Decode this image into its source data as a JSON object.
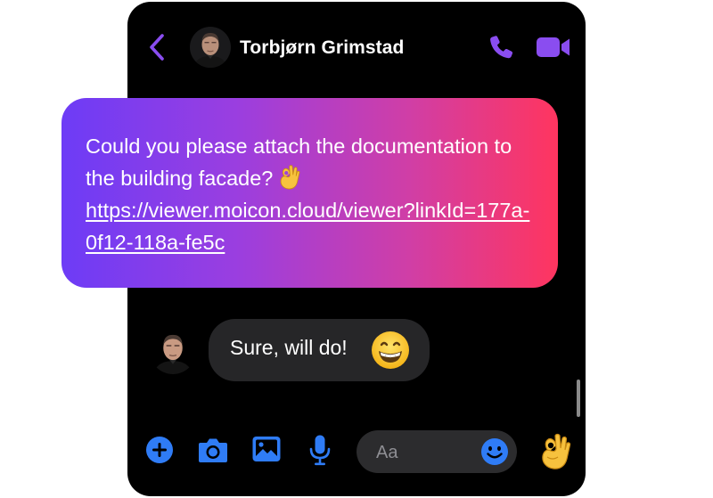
{
  "header": {
    "contact_name": "Torbjørn Grimstad"
  },
  "messages": {
    "outgoing": {
      "text": "Could you please attach the documentation to the building facade?",
      "link": "https://viewer.moicon.cloud/viewer?linkId=177a-0f12-118a-fe5c"
    },
    "incoming": {
      "text": "Sure, will do!"
    }
  },
  "composer": {
    "placeholder": "Aa"
  },
  "icons": {
    "back": "chevron-left-icon",
    "call": "phone-icon",
    "video": "video-camera-icon",
    "add": "plus-circle-icon",
    "camera": "camera-icon",
    "gallery": "image-icon",
    "voice": "microphone-icon",
    "emoji": "smiley-icon",
    "quick_reaction": "ok-hand-icon"
  },
  "colors": {
    "accent": "#8a4df0",
    "composer_icons": "#2f7cf6",
    "gradient_start": "#6d3cf6",
    "gradient_end": "#ff355f",
    "incoming_bubble": "#262628"
  }
}
